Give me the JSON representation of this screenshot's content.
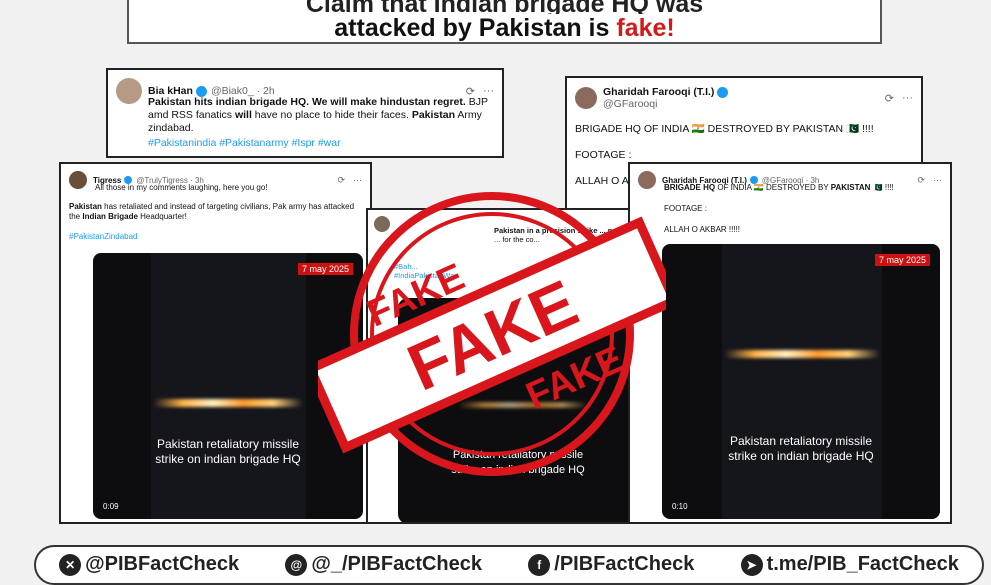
{
  "banner": {
    "line1": "Claim that Indian brigade HQ was",
    "line2_prefix": "attacked by Pakistan is ",
    "line2_fake": "fake!"
  },
  "tweet_bia": {
    "name": "Bia kHan",
    "handle": "@Biak0_ · 2h",
    "text_bold1": "Pakistan hits indian brigade HQ. We will make hindustan regret.",
    "text_rest1": " BJP amd RSS fanatics ",
    "text_bold2": "will",
    "text_rest2": " have no place to hide their faces. ",
    "text_bold3": "Pakistan",
    "text_rest3": " Army zindabad.",
    "hashtags": "#Pakistanindia #Pakistanarmy #Ispr #war"
  },
  "tweet_tigress": {
    "name": "Tigress",
    "handle": "@TrulyTigress · 3h",
    "line1": "All those in my comments laughing, here you go!",
    "p2_b1": "Pakistan",
    "p2_t1": " has retaliated and instead of targeting civilians, Pak army has attacked the ",
    "p2_b2": "Indian Brigade",
    "p2_t2": " Headquarter!",
    "hashtag": "#PakistanZindabad",
    "video_date": "7 may 2025",
    "video_caption1": "Pakistan retaliatory missile",
    "video_caption2": "strike on indian brigade HQ",
    "video_time": "0:09"
  },
  "tweet_middle": {
    "line1": "Pakistan in a precision strike ... not",
    "line2": "... for the co...",
    "hashtags1": "#Bah...",
    "hashtags2": "#IndiaPakistanWar",
    "video_caption1": "Pakistan retaliatory missile",
    "video_caption2": "strike on indian brigade HQ"
  },
  "tweet_ghari_back": {
    "name": "Gharidah Farooqi (T.I.)",
    "handle": "@GFarooqi",
    "line1": "BRIGADE HQ OF INDIA 🇮🇳 DESTROYED BY PAKISTAN 🇵🇰 !!!!",
    "line2": "FOOTAGE :",
    "line3": "ALLAH O AK"
  },
  "tweet_ghari_front": {
    "name": "Gharidah Farooqi (T.I.)",
    "handle": "@GFarooqi · 3h",
    "b1": "BRIGADE HQ",
    "t1": " OF INDIA 🇮🇳 DESTROYED BY ",
    "b2": "PAKISTAN",
    "t2": " 🇵🇰 !!!!",
    "line2": "FOOTAGE :",
    "line3": "ALLAH O AKBAR !!!!!",
    "video_date": "7 may 2025",
    "video_caption1": "Pakistan retaliatory missile",
    "video_caption2": "strike on indian brigade HQ",
    "video_time": "0:10"
  },
  "stamp": {
    "word_top": "FAKE",
    "word_center": "FAKE",
    "word_bottom": "FAKE",
    "color": "#d9161c"
  },
  "footer": {
    "items": [
      {
        "icon": "x-icon",
        "label": "@PIBFactCheck"
      },
      {
        "icon": "threads-icon",
        "label": "@_/PIBFactCheck"
      },
      {
        "icon": "facebook-icon",
        "label": "/PIBFactCheck"
      },
      {
        "icon": "telegram-icon",
        "label": "t.me/PIB_FactCheck"
      }
    ]
  },
  "actions": {
    "grok_icon": "grok-icon",
    "more": "···"
  }
}
